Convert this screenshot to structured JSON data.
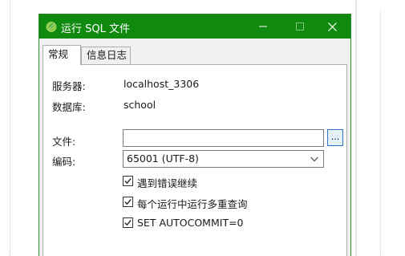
{
  "window": {
    "title": "运行 SQL 文件"
  },
  "tabs": [
    {
      "label": "常规",
      "active": true
    },
    {
      "label": "信息日志",
      "active": false
    }
  ],
  "general": {
    "server_label": "服务器:",
    "server_value": "localhost_3306",
    "database_label": "数据库:",
    "database_value": "school",
    "file_label": "文件:",
    "file_value": "",
    "browse_label": "...",
    "encoding_label": "编码:",
    "encoding_value": "65001 (UTF-8)"
  },
  "options": [
    {
      "label": "遇到错误继续",
      "checked": true
    },
    {
      "label": "每个运行中运行多重查询",
      "checked": true
    },
    {
      "label": "SET AUTOCOMMIT=0",
      "checked": true
    }
  ],
  "colors": {
    "titlebar": "#0f8a0f",
    "accent_border": "#2f72c9"
  },
  "icons": {
    "app": "navicat-leaf-icon",
    "minimize": "minimize-icon",
    "maximize": "maximize-icon",
    "close": "close-icon",
    "dropdown": "chevron-down-icon",
    "check": "checkmark-icon"
  }
}
